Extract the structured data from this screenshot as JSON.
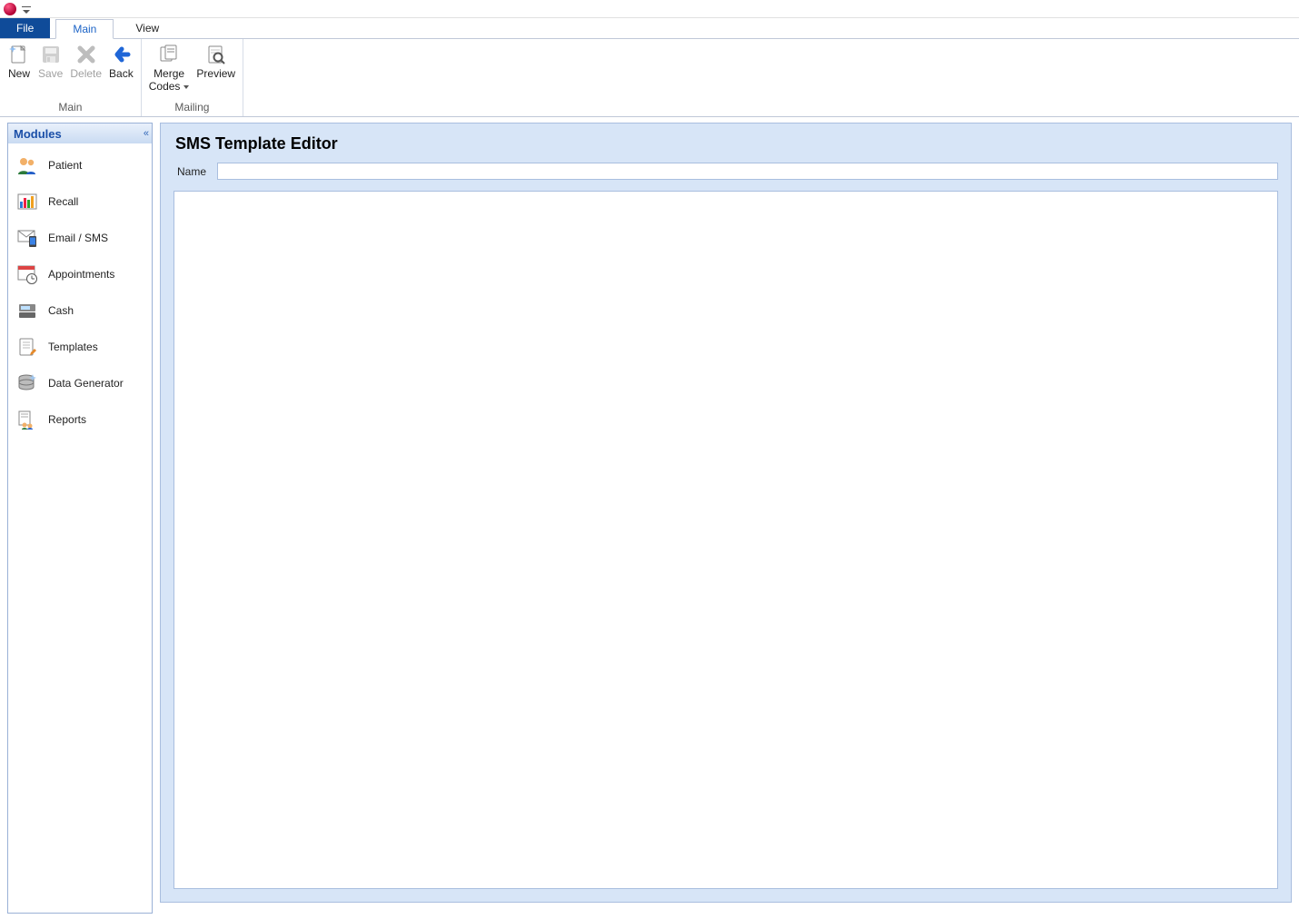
{
  "ribbon": {
    "tabs": {
      "file": "File",
      "main": "Main",
      "view": "View"
    },
    "groups": {
      "main": {
        "title": "Main",
        "buttons": {
          "new": "New",
          "save": "Save",
          "delete": "Delete",
          "back": "Back"
        }
      },
      "mailing": {
        "title": "Mailing",
        "buttons": {
          "merge_codes": "Merge\nCodes",
          "preview": "Preview"
        }
      }
    }
  },
  "sidebar": {
    "title": "Modules",
    "items": [
      {
        "id": "patient",
        "label": "Patient"
      },
      {
        "id": "recall",
        "label": "Recall"
      },
      {
        "id": "email-sms",
        "label": "Email / SMS"
      },
      {
        "id": "appointments",
        "label": "Appointments"
      },
      {
        "id": "cash",
        "label": "Cash"
      },
      {
        "id": "templates",
        "label": "Templates"
      },
      {
        "id": "data-generator",
        "label": "Data Generator"
      },
      {
        "id": "reports",
        "label": "Reports"
      }
    ]
  },
  "editor": {
    "title": "SMS Template Editor",
    "name_label": "Name",
    "name_value": ""
  },
  "colors": {
    "accent_blue": "#1b63c6",
    "file_tab_blue": "#0f4b99",
    "panel_blue": "#d7e5f7",
    "panel_border": "#a9bedf"
  }
}
